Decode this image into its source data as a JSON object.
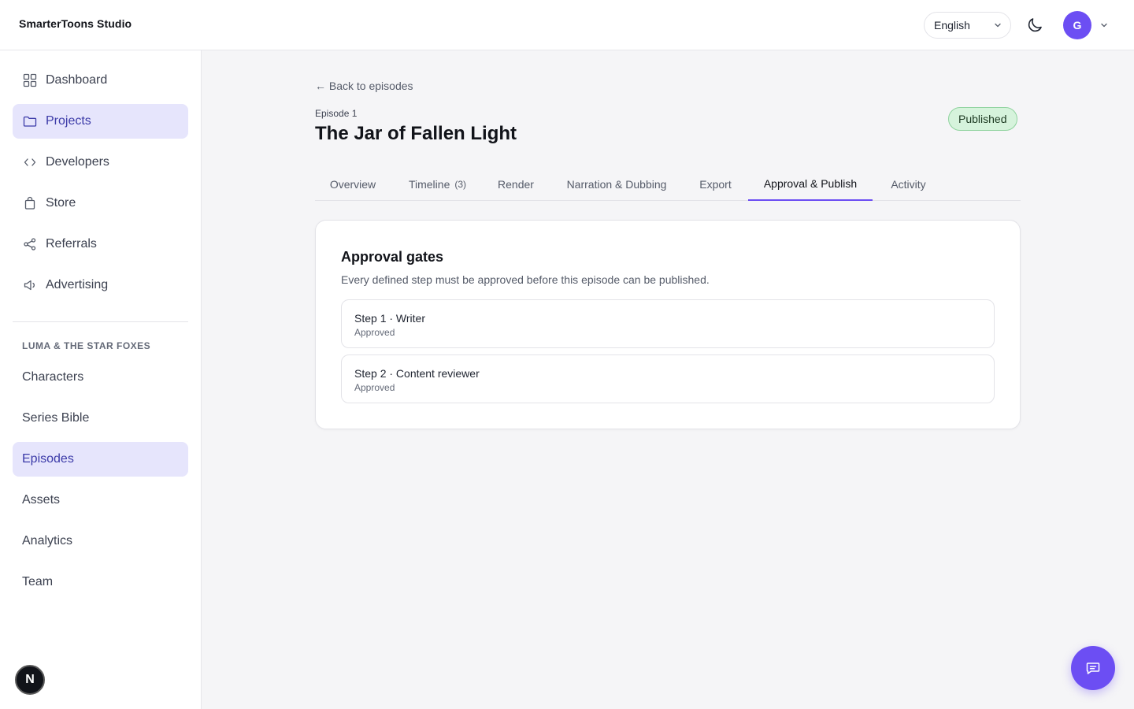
{
  "app": {
    "brand": "SmarterToons Studio"
  },
  "header": {
    "language": "English",
    "avatar_initial": "G"
  },
  "sidebar": {
    "items": [
      {
        "label": "Dashboard",
        "icon": "grid-icon"
      },
      {
        "label": "Projects",
        "icon": "folder-icon",
        "active": true
      },
      {
        "label": "Developers",
        "icon": "code-icon"
      },
      {
        "label": "Store",
        "icon": "bag-icon"
      },
      {
        "label": "Referrals",
        "icon": "share-icon"
      },
      {
        "label": "Advertising",
        "icon": "megaphone-icon"
      }
    ],
    "section_label": "LUMA & THE STAR FOXES",
    "sub_items": [
      {
        "label": "Characters"
      },
      {
        "label": "Series Bible"
      },
      {
        "label": "Episodes",
        "active": true
      },
      {
        "label": "Assets"
      },
      {
        "label": "Analytics"
      },
      {
        "label": "Team"
      }
    ],
    "bottom_badge": "N"
  },
  "episode": {
    "back_label": "← Back to episodes",
    "label": "Episode 1",
    "title": "The Jar of Fallen Light",
    "status": "Published"
  },
  "tabs": [
    {
      "label": "Overview"
    },
    {
      "label": "Timeline",
      "count": "(3)"
    },
    {
      "label": "Render"
    },
    {
      "label": "Narration & Dubbing"
    },
    {
      "label": "Export"
    },
    {
      "label": "Approval & Publish",
      "active": true
    },
    {
      "label": "Activity"
    }
  ],
  "approval": {
    "title": "Approval gates",
    "description": "Every defined step must be approved before this episode can be published.",
    "steps": [
      {
        "name": "Step 1 · Writer",
        "status": "Approved"
      },
      {
        "name": "Step 2 · Content reviewer",
        "status": "Approved"
      }
    ]
  },
  "colors": {
    "accent": "#6c4ef3",
    "active_bg": "#e6e5fc",
    "published_bg": "#d6f3dc"
  }
}
